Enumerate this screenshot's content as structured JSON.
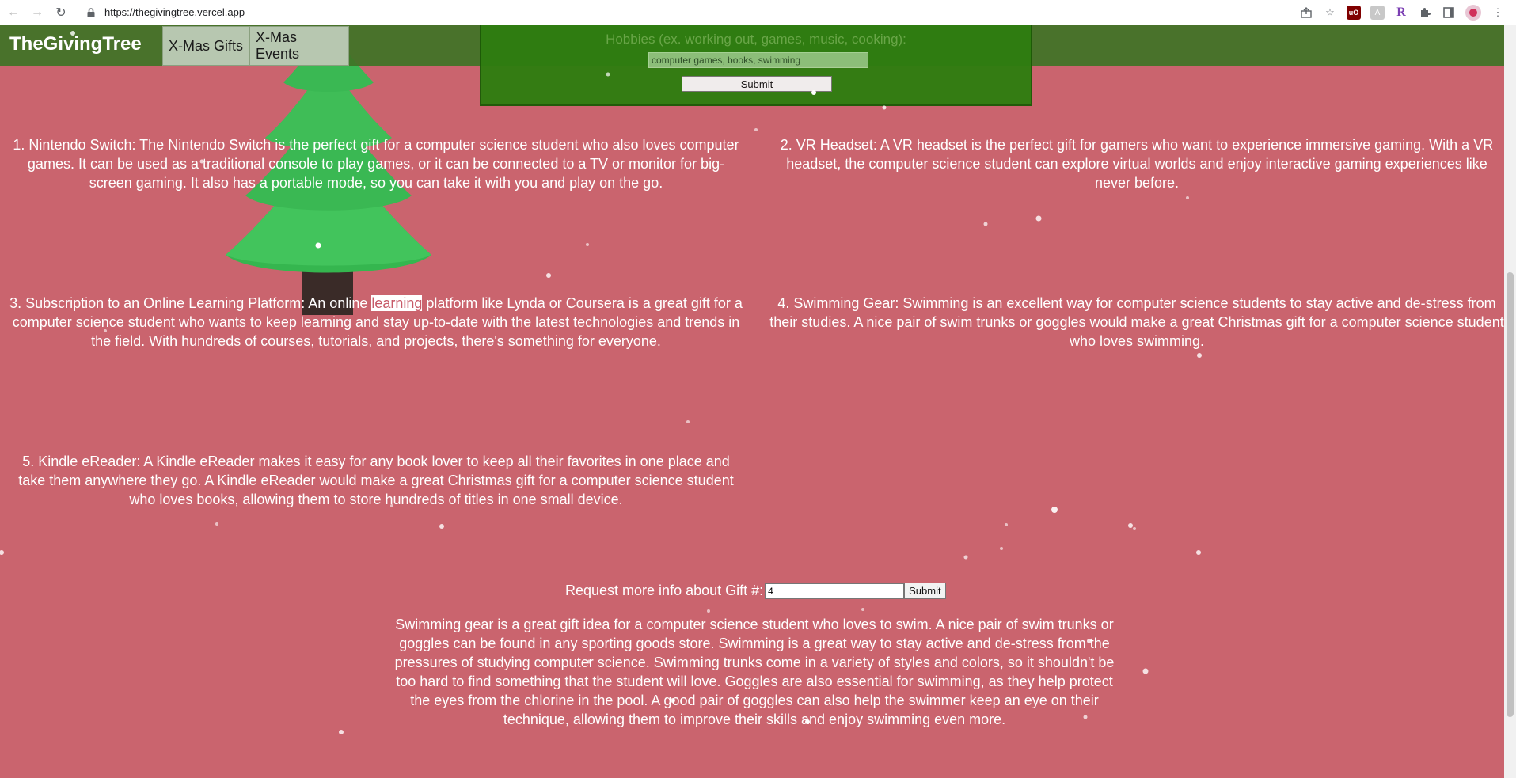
{
  "browser": {
    "url": "https://thegivingtree.vercel.app",
    "icons": [
      "back-arrow-icon",
      "forward-arrow-icon",
      "reload-icon",
      "lock-icon",
      "share-icon",
      "star-icon",
      "ublock-icon",
      "extension-icon",
      "r-extension-icon",
      "puzzle-icon",
      "side-panel-icon",
      "profile-avatar-icon",
      "kebab-menu-icon"
    ]
  },
  "header": {
    "brand": "TheGivingTree",
    "tabs": [
      {
        "label": "X-Mas Gifts"
      },
      {
        "label": "X-Mas Events"
      }
    ]
  },
  "hobby_form": {
    "label": "Hobbies (ex. working out, games, music, cooking):",
    "input_value": "computer games, books, swimming",
    "submit_label": "Submit"
  },
  "gifts": [
    {
      "text_before": "1. Nintendo Switch: The Nintendo Switch is the perfect gift for a computer science student who also loves computer games. It can be used as a traditional console to play games, or it can be connected to a TV or monitor for big-screen gaming. It also has a portable mode, so you can take it with you and play on the go."
    },
    {
      "text_before": "2. VR Headset: A VR headset is the perfect gift for gamers who want to experience immersive gaming. With a VR headset, the computer science student can explore virtual worlds and enjoy interactive gaming experiences like never before."
    },
    {
      "text_before": "3. Subscription to an Online Learning Platform: An online ",
      "highlight": "learning",
      "text_after": " platform like Lynda or Coursera is a great gift for a computer science student who wants to keep learning and stay up-to-date with the latest technologies and trends in the field. With hundreds of courses, tutorials, and projects, there's something for everyone."
    },
    {
      "text_before": "4. Swimming Gear: Swimming is an excellent way for computer science students to stay active and de-stress from their studies. A nice pair of swim trunks or goggles would make a great Christmas gift for a computer science student who loves swimming."
    },
    {
      "text_before": "5. Kindle eReader: A Kindle eReader makes it easy for any book lover to keep all their favorites in one place and take them anywhere they go. A Kindle eReader would make a great Christmas gift for a computer science student who loves books, allowing them to store hundreds of titles in one small device."
    }
  ],
  "request": {
    "label": "Request more info about Gift #:",
    "input_value": "4",
    "submit_label": "Submit"
  },
  "info_text": "Swimming gear is a great gift idea for a computer science student who loves to swim. A nice pair of swim trunks or goggles can be found in any sporting goods store. Swimming is a great way to stay active and de-stress from the pressures of studying computer science. Swimming trunks come in a variety of styles and colors, so it shouldn't be too hard to find something that the student will love. Goggles are also essential for swimming, as they help protect the eyes from the chlorine in the pool. A good pair of goggles can also help the swimmer keep an eye on their technique, allowing them to improve their skills and enjoy swimming even more.",
  "colors": {
    "page_background": "#ca646e",
    "header_green": "#3f7326",
    "tab_background": "#b7c7b0",
    "form_panel_green": "#2e7d10",
    "tree_green": "#3fbd57",
    "trunk_brown": "#3a2b28",
    "snow": "#ffffff"
  }
}
